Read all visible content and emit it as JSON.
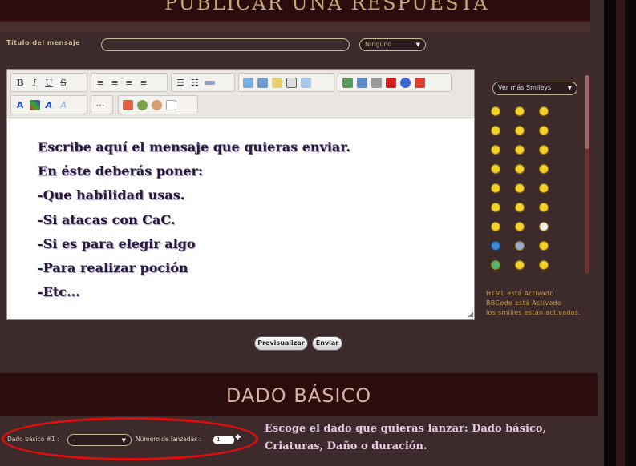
{
  "header": {
    "title": "PUBLICAR UNA RESPUESTA"
  },
  "form": {
    "title_label": "Título del mensaje",
    "title_value": "",
    "icon_select": "Ninguno"
  },
  "editor": {
    "lines": [
      "Escribe aquí el mensaje que quieras enviar.",
      "En éste deberás poner:",
      "-Que habilidad usas.",
      "-Si atacas con CaC.",
      "-Si es para elegir algo",
      "-Para realizar poción",
      "-Etc..."
    ],
    "toolbar": {
      "bold": "B",
      "italic": "I",
      "underline": "U",
      "strike": "S",
      "font_color": "A"
    }
  },
  "smileys": {
    "select_label": "Ver más Smileys",
    "icons": [
      "smile-icon",
      "happy-icon",
      "laugh-icon",
      "neutral-icon",
      "glasses-icon",
      "cool-icon",
      "grin-icon",
      "angry-icon",
      "wink-icon",
      "confused-icon",
      "sad-icon",
      "mad-icon",
      "shocked-icon",
      "sweat-icon",
      "rolleyes-icon",
      "exclamation-icon",
      "question-icon",
      "surprised-icon",
      "yellow-ball-icon",
      "shy-icon",
      "skull-icon",
      "star-icon",
      "blue-face-icon",
      "heart-face-icon",
      "green-face-icon",
      "dizzy-icon",
      "eye-icon"
    ]
  },
  "status": {
    "html": "HTML está Activado",
    "bbcode": "BBCode está Activado",
    "smilies": "los smilies están activados."
  },
  "actions": {
    "preview": "Previsualizar",
    "send": "Enviar"
  },
  "dado": {
    "title": "DADO BÁSICO",
    "dice_label": "Dado básico #1 :",
    "dice_value": "-",
    "count_label": "Número de lanzadas :",
    "count_value": "1",
    "description": "Escoge el dado que quieras lanzar: Dado básico, Criaturas, Daño o duración."
  },
  "colors": {
    "banner": "#2c0d0e",
    "background": "#3d2b2c",
    "highlight": "#e10d0d"
  }
}
